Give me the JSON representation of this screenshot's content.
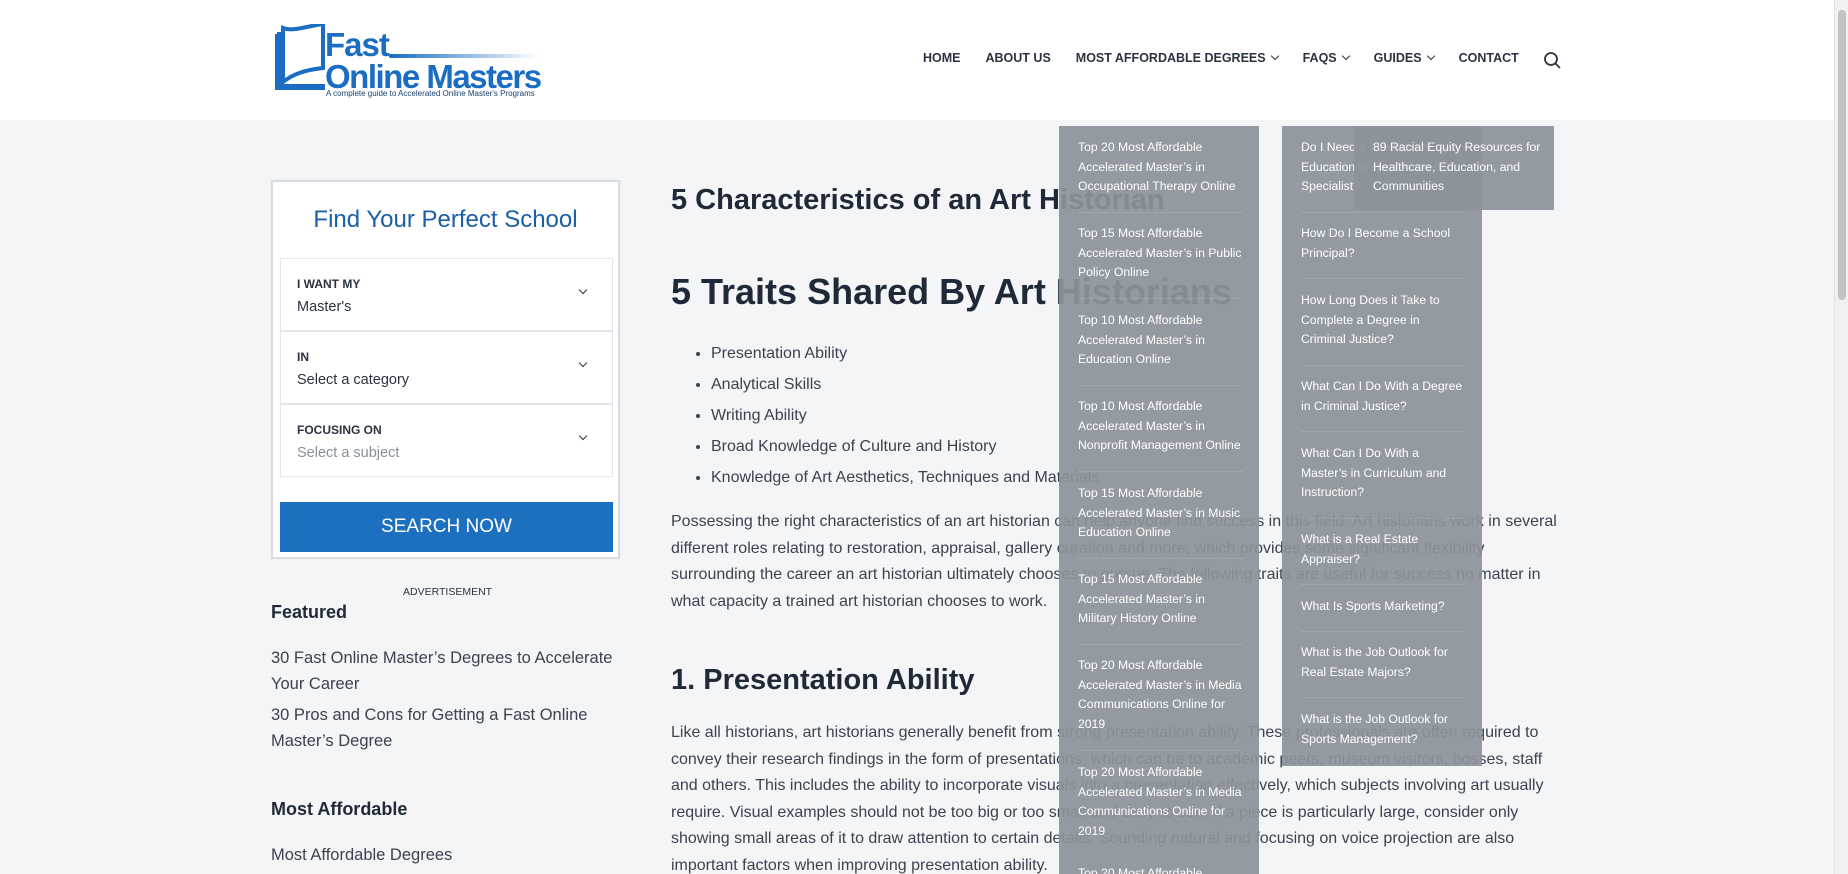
{
  "logo": {
    "line1": "Fast",
    "line2": "Online Masters",
    "tagline": "A complete guide to Accelerated Online Master's Programs"
  },
  "nav": [
    {
      "label": "HOME",
      "has_dropdown": false
    },
    {
      "label": "ABOUT US",
      "has_dropdown": false
    },
    {
      "label": "MOST AFFORDABLE DEGREES",
      "has_dropdown": true
    },
    {
      "label": "FAQS",
      "has_dropdown": true
    },
    {
      "label": "GUIDES",
      "has_dropdown": true
    },
    {
      "label": "CONTACT",
      "has_dropdown": false
    }
  ],
  "finder": {
    "title": "Find Your Perfect School",
    "fields": [
      {
        "label": "I WANT MY",
        "value": "Master's"
      },
      {
        "label": "IN",
        "value": "Select a category"
      },
      {
        "label": "FOCUSING ON",
        "value": "Select a subject"
      }
    ],
    "button": "SEARCH NOW"
  },
  "advertisement": "ADVERTISEMENT",
  "sidebar": {
    "featured_heading": "Featured",
    "featured": [
      "30 Fast Online Master’s Degrees to Accelerate Your Career",
      "30 Pros and Cons for Getting a Fast Online Master’s Degree"
    ],
    "affordable_heading": "Most Affordable",
    "affordable": [
      "Most Affordable Degrees"
    ]
  },
  "article": {
    "title": "5 Characteristics of an Art Historian",
    "subtitle": "5 Traits Shared By Art Historians",
    "traits": [
      "Presentation Ability",
      "Analytical Skills",
      "Writing Ability",
      "Broad Knowledge of Culture and History",
      "Knowledge of Art Aesthetics, Techniques and Materials"
    ],
    "intro": "Possessing the right characteristics of an art historian can help anyone find success in this field. Art historians work in several different roles relating to restoration, appraisal, gallery curation and more, which provides some significant flexibility surrounding the career an art historian ultimately chooses to pursue. The following traits are useful for success no matter in what capacity a trained art historian chooses to work.",
    "section1_heading": "1. Presentation Ability",
    "section1_text": "Like all historians, art historians generally benefit from strong presentation ability. These professionals are often required to convey their research findings in the form of presentations, which can be to academic peers, museum visitors, bosses, staff and others. This includes the ability to incorporate visuals into a presentation effectively, which subjects involving art usually require. Visual examples should not be too big or too small and easy to see. If a piece is particularly large, consider only showing small areas of it to draw attention to certain details. Sounding natural and focusing on voice projection are also important factors when improving presentation ability."
  },
  "affordable_menu": [
    "Top 20 Most Affordable Accelerated Master’s in Occupational Therapy Online",
    "Top 15 Most Affordable Accelerated Master’s in Public Policy Online",
    "Top 10 Most Affordable Accelerated Master’s in Education Online",
    "Top 10 Most Affordable Accelerated Master’s in Nonprofit Management Online",
    "Top 15 Most Affordable Accelerated Master’s in Music Education Online",
    "Top 15 Most Affordable Accelerated Master’s in Military History Online",
    "Top 20 Most Affordable Accelerated Master’s in Media Communications Online for 2019",
    "Top 20 Most Affordable Accelerated Master’s in Media Communications Online for 2019",
    "Top 20 Most Affordable"
  ],
  "faqs_menu": [
    "Do I Need a Master’s in Education to Be a Reading Specialist?",
    "How Do I Become a School Principal?",
    "How Long Does it Take to Complete a Degree in Criminal Justice?",
    "What Can I Do With a Degree in Criminal Justice?",
    "What Can I Do With a Master’s in Curriculum and Instruction?",
    "What is a Real Estate Appraiser?",
    "What Is Sports Marketing?",
    "What is the Job Outlook for Real Estate Majors?",
    "What is the Job Outlook for Sports Management?"
  ],
  "guides_menu": [
    "89 Racial Equity Resources for Healthcare, Education, and Communities"
  ],
  "colors": {
    "brand": "#1a6dc2",
    "button": "#1d6fbf",
    "dropdown_bg": "#8c929a"
  }
}
